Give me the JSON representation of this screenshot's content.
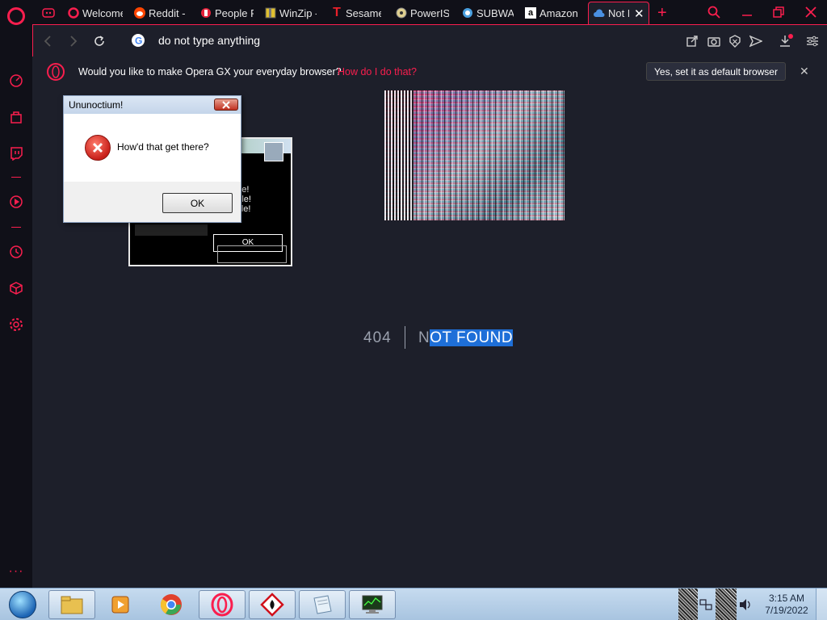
{
  "tabs": [
    {
      "label": "Welcome",
      "icon": "opera-icon",
      "color": "#fa1e4e"
    },
    {
      "label": "Reddit -",
      "icon": "reddit-icon",
      "color": "#ff4500"
    },
    {
      "label": "People P",
      "icon": "people-icon",
      "color": "#e4213a"
    },
    {
      "label": "WinZip -",
      "icon": "winzip-icon",
      "color": "#e0c030"
    },
    {
      "label": "Sesame",
      "icon": "sesame-icon",
      "color": "#e8202a"
    },
    {
      "label": "PowerIS",
      "icon": "poweriso-icon",
      "color": "#e0d090"
    },
    {
      "label": "SUBWAY",
      "icon": "subway-icon",
      "color": "#4aa0e0"
    },
    {
      "label": "Amazon",
      "icon": "amazon-icon",
      "color": "#ffffff"
    },
    {
      "label": "Not F",
      "icon": "cloud-icon",
      "color": "#4a90e2"
    }
  ],
  "address": {
    "url": "do not type anything"
  },
  "infobar": {
    "message": "Would you like to make Opera GX your everyday browser?",
    "link": "How do I do that?",
    "button": "Yes, set it as default browser"
  },
  "error": {
    "code": "404",
    "text_first": "N",
    "text_selected": "OT FOUND"
  },
  "dialog": {
    "title": "Ununoctium!",
    "message": "How'd that get there?",
    "ok": "OK"
  },
  "ghost_dialog": {
    "line1": "rule!",
    "line2": "s rule!",
    "line3": "ys rule!",
    "ok": "OK"
  },
  "taskbar": {
    "time": "3:15 AM",
    "date": "7/19/2022"
  },
  "colors": {
    "accent": "#fa1e4e",
    "selection": "#1e6fd8"
  }
}
